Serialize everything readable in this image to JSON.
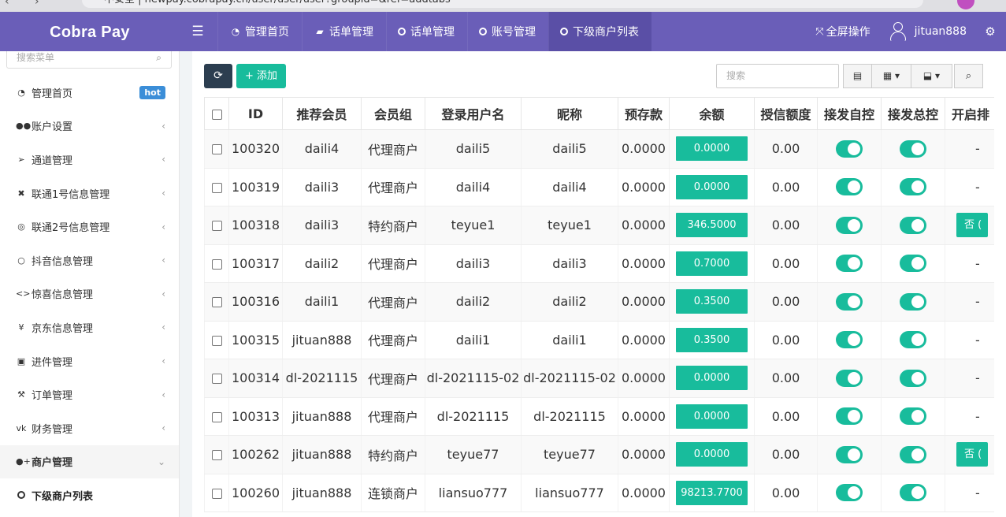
{
  "browser": {
    "url": "不安全 | newpay.cobrapay.cn/user/user/user?groupid=&ref=addtabs"
  },
  "brand": {
    "logo": "Cobra Pay",
    "accent": "#6a5eb8",
    "green": "#18bc9c",
    "dark": "#2c3e50"
  },
  "topnav": {
    "tabs": [
      {
        "label": "管理首页",
        "icon": "dashboard-icon"
      },
      {
        "label": "话单管理",
        "icon": "book-icon"
      },
      {
        "label": "话单管理",
        "icon": "circle-icon"
      },
      {
        "label": "账号管理",
        "icon": "circle-icon"
      },
      {
        "label": "下级商户列表",
        "icon": "circle-icon",
        "active": true
      }
    ],
    "fullscreen": "全屏操作",
    "username": "jituan888"
  },
  "sidebar": {
    "search_placeholder": "搜索菜单",
    "items": [
      {
        "label": "管理首页",
        "icon": "dashboard-icon",
        "badge": "hot"
      },
      {
        "label": "账户设置",
        "icon": "users-icon"
      },
      {
        "label": "通道管理",
        "icon": "send-icon"
      },
      {
        "label": "联通1号信息管理",
        "icon": "tools-icon"
      },
      {
        "label": "联通2号信息管理",
        "icon": "target-icon"
      },
      {
        "label": "抖音信息管理",
        "icon": "circle-icon"
      },
      {
        "label": "惊喜信息管理",
        "icon": "code-icon"
      },
      {
        "label": "京东信息管理",
        "icon": "yen-icon"
      },
      {
        "label": "进件管理",
        "icon": "file-icon"
      },
      {
        "label": "订单管理",
        "icon": "gavel-icon"
      },
      {
        "label": "财务管理",
        "icon": "vk-icon"
      },
      {
        "label": "商户管理",
        "icon": "user-plus-icon",
        "expanded": true
      }
    ],
    "sub_item": "下级商户列表"
  },
  "toolbar": {
    "add_label": "添加",
    "search_placeholder": "搜索"
  },
  "table": {
    "headers": [
      "ID",
      "推荐会员",
      "会员组",
      "登录用户名",
      "昵称",
      "预存款",
      "余额",
      "授信额度",
      "接发自控",
      "接发总控",
      "开启排"
    ],
    "rows": [
      {
        "id": "100320",
        "referrer": "daili4",
        "group": "代理商户",
        "username": "daili5",
        "nickname": "daili5",
        "deposit": "0.0000",
        "balance": "0.0000",
        "credit": "0.00",
        "open": "-"
      },
      {
        "id": "100319",
        "referrer": "daili3",
        "group": "代理商户",
        "username": "daili4",
        "nickname": "daili4",
        "deposit": "0.0000",
        "balance": "0.0000",
        "credit": "0.00",
        "open": "-"
      },
      {
        "id": "100318",
        "referrer": "daili3",
        "group": "特约商户",
        "username": "teyue1",
        "nickname": "teyue1",
        "deposit": "0.0000",
        "balance": "346.5000",
        "credit": "0.00",
        "open": "否 ("
      },
      {
        "id": "100317",
        "referrer": "daili2",
        "group": "代理商户",
        "username": "daili3",
        "nickname": "daili3",
        "deposit": "0.0000",
        "balance": "0.7000",
        "credit": "0.00",
        "open": "-"
      },
      {
        "id": "100316",
        "referrer": "daili1",
        "group": "代理商户",
        "username": "daili2",
        "nickname": "daili2",
        "deposit": "0.0000",
        "balance": "0.3500",
        "credit": "0.00",
        "open": "-"
      },
      {
        "id": "100315",
        "referrer": "jituan888",
        "group": "代理商户",
        "username": "daili1",
        "nickname": "daili1",
        "deposit": "0.0000",
        "balance": "0.3500",
        "credit": "0.00",
        "open": "-"
      },
      {
        "id": "100314",
        "referrer": "dl-2021115",
        "group": "代理商户",
        "username": "dl-2021115-02",
        "nickname": "dl-2021115-02",
        "deposit": "0.0000",
        "balance": "0.0000",
        "credit": "0.00",
        "open": "-"
      },
      {
        "id": "100313",
        "referrer": "jituan888",
        "group": "代理商户",
        "username": "dl-2021115",
        "nickname": "dl-2021115",
        "deposit": "0.0000",
        "balance": "0.0000",
        "credit": "0.00",
        "open": "-"
      },
      {
        "id": "100262",
        "referrer": "jituan888",
        "group": "特约商户",
        "username": "teyue77",
        "nickname": "teyue77",
        "deposit": "0.0000",
        "balance": "0.0000",
        "credit": "0.00",
        "open": "否 ("
      },
      {
        "id": "100260",
        "referrer": "jituan888",
        "group": "连锁商户",
        "username": "liansuo777",
        "nickname": "liansuo777",
        "deposit": "0.0000",
        "balance": "98213.7700",
        "credit": "0.00",
        "open": "-"
      }
    ]
  }
}
